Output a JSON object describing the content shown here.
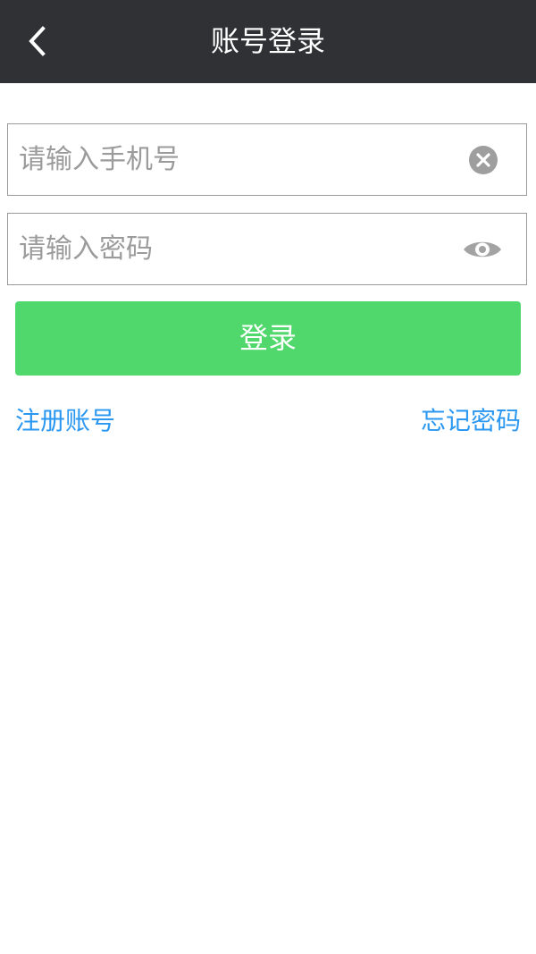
{
  "header": {
    "title": "账号登录",
    "back_icon": "chevron-left-icon"
  },
  "form": {
    "phone": {
      "placeholder": "请输入手机号",
      "value": "",
      "clear_icon": "clear-circle-icon"
    },
    "password": {
      "placeholder": "请输入密码",
      "value": "",
      "visibility_icon": "eye-icon"
    },
    "login_label": "登录"
  },
  "links": {
    "register": "注册账号",
    "forgot_password": "忘记密码"
  },
  "colors": {
    "header_bg": "#2f3134",
    "primary_green": "#51d86c",
    "link_blue": "#2a97f0",
    "icon_gray": "#9e9e9e",
    "border_gray": "#9a9a9a"
  }
}
